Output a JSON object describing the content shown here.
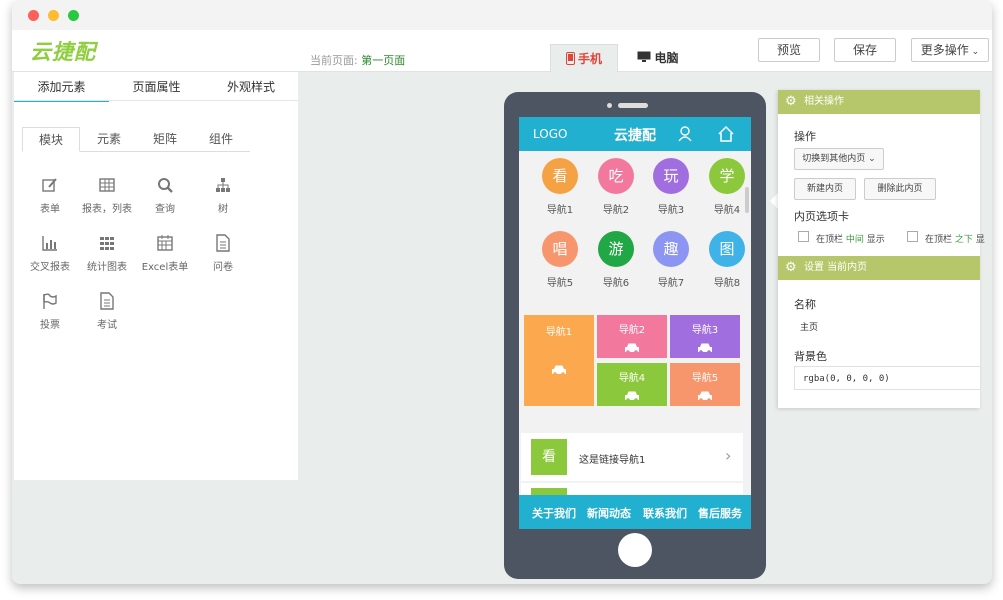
{
  "colors": {
    "accent": "#21b0cf",
    "green": "#8fce3f",
    "panel_header": "#b5c76a"
  },
  "brand": {
    "logo_text": "云捷配"
  },
  "header": {
    "current_page_label": "当前页面:",
    "current_page_value": "第一页面",
    "tab_mobile": "手机",
    "tab_desktop": "电脑",
    "preview": "预览",
    "save": "保存",
    "more": "更多操作"
  },
  "sidebar": {
    "tabs": [
      "添加元素",
      "页面属性",
      "外观样式"
    ],
    "subtabs": [
      "模块",
      "元素",
      "矩阵",
      "组件"
    ],
    "tools": [
      "表单",
      "报表，列表",
      "查询",
      "树",
      "交叉报表",
      "统计图表",
      "Excel表单",
      "问卷",
      "投票",
      "考试"
    ]
  },
  "phone": {
    "logo": "LOGO",
    "title": "云捷配",
    "circles": [
      {
        "char": "看",
        "label": "导航1",
        "color": "#f5a245"
      },
      {
        "char": "吃",
        "label": "导航2",
        "color": "#f2789e"
      },
      {
        "char": "玩",
        "label": "导航3",
        "color": "#a16ee0"
      },
      {
        "char": "学",
        "label": "导航4",
        "color": "#8cc83c"
      },
      {
        "char": "唱",
        "label": "导航5",
        "color": "#f7956c"
      },
      {
        "char": "游",
        "label": "导航6",
        "color": "#21a745"
      },
      {
        "char": "趣",
        "label": "导航7",
        "color": "#8c96f2"
      },
      {
        "char": "图",
        "label": "导航8",
        "color": "#3fb3e8"
      }
    ],
    "tiles": [
      {
        "label": "导航1",
        "color": "#fba84e"
      },
      {
        "label": "导航2",
        "color": "#f2789e"
      },
      {
        "label": "导航3",
        "color": "#a16ee0"
      },
      {
        "label": "导航4",
        "color": "#8cc83c"
      },
      {
        "label": "导航5",
        "color": "#f7956c"
      }
    ],
    "link_char": "看",
    "link_text": "这是链接导航1",
    "footer": [
      "关于我们",
      "新闻动态",
      "联系我们",
      "售后服务"
    ]
  },
  "panel": {
    "related_ops": "相关操作",
    "ops_label": "操作",
    "switch_btn": "切换到其他内页",
    "new_btn": "新建内页",
    "delete_btn": "删除此内页",
    "tab_label": "内页选项卡",
    "cb1_a": "在顶栏",
    "cb1_b": "中间",
    "cb1_c": "显示",
    "cb2_a": "在顶栏",
    "cb2_b": "之下",
    "cb2_c": "显",
    "settings_title": "设置 当前内页",
    "name_label": "名称",
    "name_value": "主页",
    "bg_label": "背景色",
    "bg_value": "rgba(0, 0, 0, 0)"
  }
}
